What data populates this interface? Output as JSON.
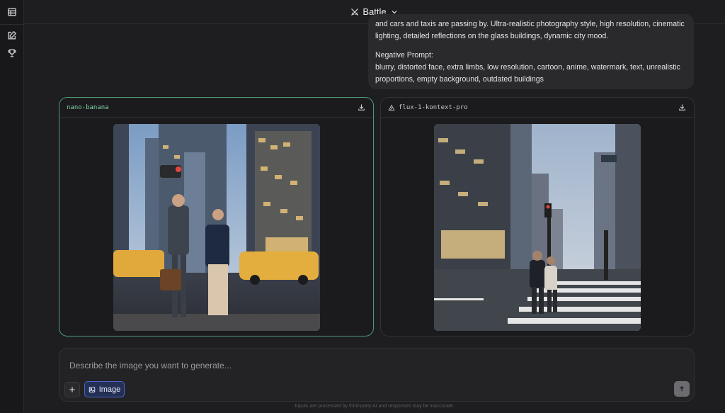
{
  "header": {
    "mode_label": "Battle"
  },
  "prompt": {
    "line1": "and cars and taxis are passing by. Ultra-realistic photography style, high resolution, cinematic",
    "line2": "lighting, detailed reflections on the glass buildings, dynamic city mood.",
    "negative_title": "Negative Prompt:",
    "negative_line1": "blurry, distorted face, extra limbs, low resolution, cartoon, anime, watermark, text, unrealistic",
    "negative_line2": "proportions, empty background, outdated buildings"
  },
  "results": [
    {
      "model": "nano-banana",
      "selected": true
    },
    {
      "model": "flux-1-kontext-pro",
      "selected": false
    }
  ],
  "composer": {
    "placeholder": "Describe the image you want to generate...",
    "image_button_label": "Image"
  },
  "footer": {
    "note": "Inputs are processed by third-party AI and responses may be inaccurate."
  },
  "icons": {
    "sidebar": [
      "table-icon",
      "edit-icon",
      "trophy-icon"
    ],
    "header": "swords-icon",
    "download": "download-icon",
    "send": "arrow-up-icon"
  },
  "colors": {
    "selected_border": "#4f9a7a",
    "model_green": "#7fd1a2",
    "image_button": "#4a64c9"
  }
}
